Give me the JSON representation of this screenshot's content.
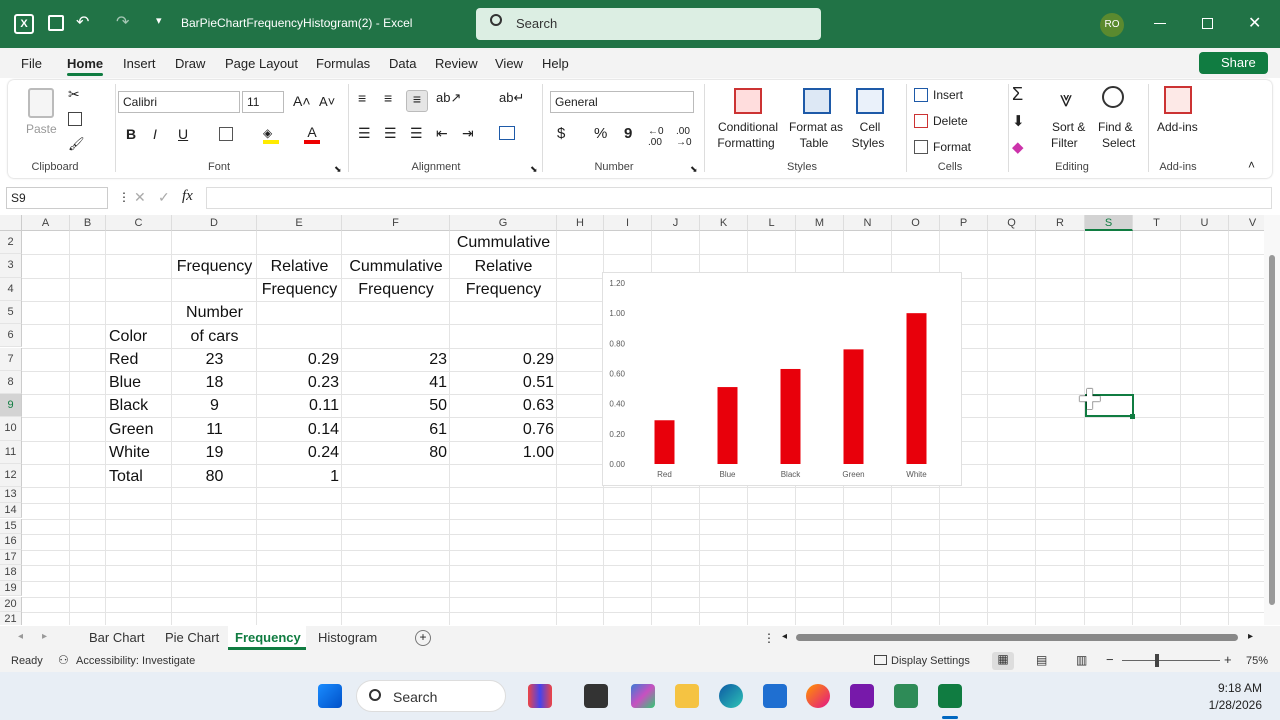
{
  "window": {
    "title": "BarPieChartFrequencyHistogram(2)  -  Excel",
    "search_placeholder": "Search",
    "user_initials": "RO"
  },
  "menu": [
    "File",
    "Home",
    "Insert",
    "Draw",
    "Page Layout",
    "Formulas",
    "Data",
    "Review",
    "View",
    "Help"
  ],
  "share_label": "Share",
  "ribbon": {
    "paste": "Paste",
    "clipboard": "Clipboard",
    "font_name": "Calibri",
    "font_size": "11",
    "font": "Font",
    "alignment": "Alignment",
    "number_format": "General",
    "number": "Number",
    "cond1": "Conditional",
    "cond2": "Formatting",
    "fat1": "Format as",
    "fat2": "Table",
    "cs1": "Cell",
    "cs2": "Styles",
    "styles": "Styles",
    "insert": "Insert",
    "delete": "Delete",
    "format": "Format",
    "cells": "Cells",
    "sort1": "Sort &",
    "sort2": "Filter",
    "find1": "Find &",
    "find2": "Select",
    "editing": "Editing",
    "addins": "Add-ins",
    "addins_grp": "Add-ins",
    "bold": "B",
    "italic": "I",
    "underline": "U",
    "dollar": "$",
    "percent": "%",
    "comma": "9"
  },
  "formula_bar": {
    "name_box": "S9",
    "fx": "fx",
    "content": ""
  },
  "columns": [
    "A",
    "B",
    "C",
    "D",
    "E",
    "F",
    "G",
    "H",
    "I",
    "J",
    "K",
    "L",
    "M",
    "N",
    "O",
    "P",
    "Q",
    "R",
    "S",
    "T",
    "U",
    "V"
  ],
  "rows": [
    "2",
    "3",
    "4",
    "5",
    "6",
    "7",
    "8",
    "9",
    "10",
    "11",
    "12",
    "13",
    "14",
    "15",
    "16",
    "17",
    "18",
    "19",
    "20",
    "21"
  ],
  "cells": {
    "g2": "Cummulative",
    "d3": "Frequency",
    "e3": "Relative",
    "f3": "Cummulative",
    "g3": "Relative",
    "e4": "Frequency",
    "f4": "Frequency",
    "g4": "Frequency",
    "d5": "Number",
    "c6": "Color",
    "d6": "of cars",
    "table": [
      {
        "c": "Red",
        "d": "23",
        "e": "0.29",
        "f": "23",
        "g": "0.29"
      },
      {
        "c": "Blue",
        "d": "18",
        "e": "0.23",
        "f": "41",
        "g": "0.51"
      },
      {
        "c": "Black",
        "d": "9",
        "e": "0.11",
        "f": "50",
        "g": "0.63"
      },
      {
        "c": "Green",
        "d": "11",
        "e": "0.14",
        "f": "61",
        "g": "0.76"
      },
      {
        "c": "White",
        "d": "19",
        "e": "0.24",
        "f": "80",
        "g": "1.00"
      }
    ],
    "total_label": "Total",
    "total_d": "80",
    "total_e": "1"
  },
  "chart_data": {
    "type": "bar",
    "categories": [
      "Red",
      "Blue",
      "Black",
      "Green",
      "White"
    ],
    "values": [
      0.29,
      0.51,
      0.63,
      0.76,
      1.0
    ],
    "yticks": [
      "0.00",
      "0.20",
      "0.40",
      "0.60",
      "0.80",
      "1.00",
      "1.20"
    ],
    "ylim": [
      0,
      1.2
    ],
    "bar_color": "#e8000b",
    "grid": false
  },
  "sheets": [
    "Bar Chart",
    "Pie Chart",
    "Frequency",
    "Histogram"
  ],
  "active_sheet": "Frequency",
  "status": {
    "ready": "Ready",
    "accessibility": "Accessibility: Investigate",
    "display": "Display Settings",
    "zoom": "75%"
  },
  "taskbar": {
    "search": "Search",
    "time": "9:18 AM",
    "date": "1/28/2026"
  },
  "colors": {
    "excel_green": "#217346",
    "accent": "#107c41"
  }
}
